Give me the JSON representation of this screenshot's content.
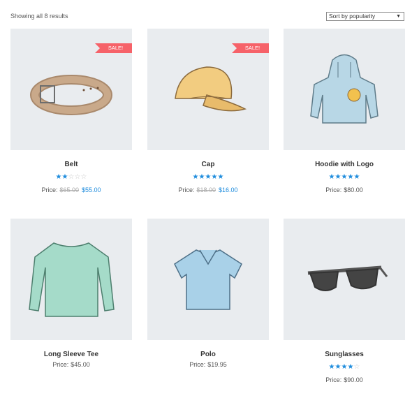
{
  "result_count": "Showing all 8 results",
  "sort": {
    "selected": "Sort by popularity"
  },
  "price_label": "Price:",
  "products": [
    {
      "name": "Belt",
      "sale": "SALE!",
      "rating": 2,
      "old_price": "$65.00",
      "price": "$55.00",
      "icon": "belt-icon"
    },
    {
      "name": "Cap",
      "sale": "SALE!",
      "rating": 5,
      "old_price": "$18.00",
      "price": "$16.00",
      "icon": "cap-icon"
    },
    {
      "name": "Hoodie with Logo",
      "rating": 5,
      "price": "$80.00",
      "icon": "hoodie-icon"
    },
    {
      "name": "Long Sleeve Tee",
      "price": "$45.00",
      "icon": "long-sleeve-tee-icon"
    },
    {
      "name": "Polo",
      "price": "$19.95",
      "icon": "polo-shirt-icon"
    },
    {
      "name": "Sunglasses",
      "rating": 4,
      "price": "$90.00",
      "icon": "sunglasses-icon"
    }
  ],
  "colors": {
    "accent": "#1e8cdd",
    "sale": "#f66269",
    "thumb_bg": "#e9ecef"
  }
}
